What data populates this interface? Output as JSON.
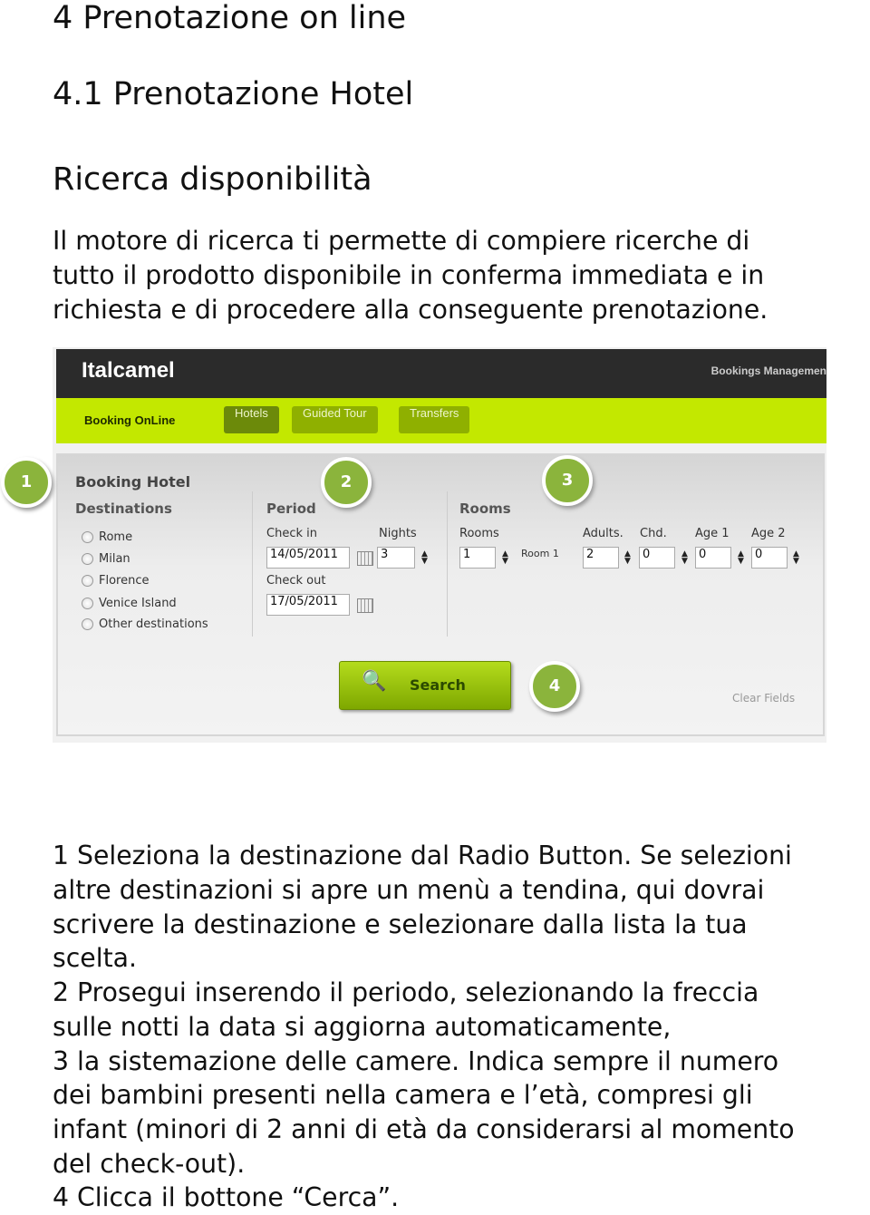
{
  "headings": [
    "4 Prenotazione on line",
    "4.1 Prenotazione Hotel",
    "Ricerca disponibilità"
  ],
  "intro": [
    "Il motore di ricerca ti permette di compiere ricerche di",
    "tutto il prodotto disponibile in conferma immediata e in",
    "richiesta e di procedere alla conseguente prenotazione."
  ],
  "app": {
    "logo": "Italcamel",
    "bookings_management": "Bookings Managemen",
    "booking_online": "Booking OnLine",
    "tabs": [
      "Hotels",
      "Guided Tour",
      "Transfers"
    ],
    "accent": "#c3e800",
    "title": "Booking Hotel",
    "destinations": {
      "label": "Destinations",
      "options": [
        "Rome",
        "Milan",
        "Florence",
        "Venice Island",
        "Other destinations"
      ]
    },
    "period": {
      "label": "Period",
      "checkin_label": "Check in",
      "checkin": "14/05/2011",
      "nights_label": "Nights",
      "nights": "3",
      "checkout_label": "Check out",
      "checkout": "17/05/2011"
    },
    "rooms": {
      "label": "Rooms",
      "rooms_label": "Rooms",
      "rooms": "1",
      "room_name": "Room 1",
      "adults_label": "Adults.",
      "adults": "2",
      "chd_label": "Chd.",
      "chd": "0",
      "age1_label": "Age 1",
      "age1": "0",
      "age2_label": "Age 2",
      "age2": "0"
    },
    "search": "Search",
    "clear": "Clear Fields",
    "markers": [
      "1",
      "2",
      "3",
      "4"
    ]
  },
  "body": [
    "1 Seleziona la destinazione dal Radio Button. Se selezioni",
    "altre destinazioni si apre un menù a tendina, qui dovrai",
    "scrivere la destinazione e selezionare dalla lista la tua",
    "scelta.",
    "2 Prosegui inserendo il periodo, selezionando la freccia",
    "sulle notti la data si aggiorna automaticamente,",
    "3 la sistemazione delle camere. Indica sempre il numero",
    "dei bambini presenti nella camera e l’età, compresi gli",
    "infant (minori di 2 anni di età da considerarsi al momento",
    "del check-out).",
    "4 Clicca il bottone “Cerca”."
  ]
}
